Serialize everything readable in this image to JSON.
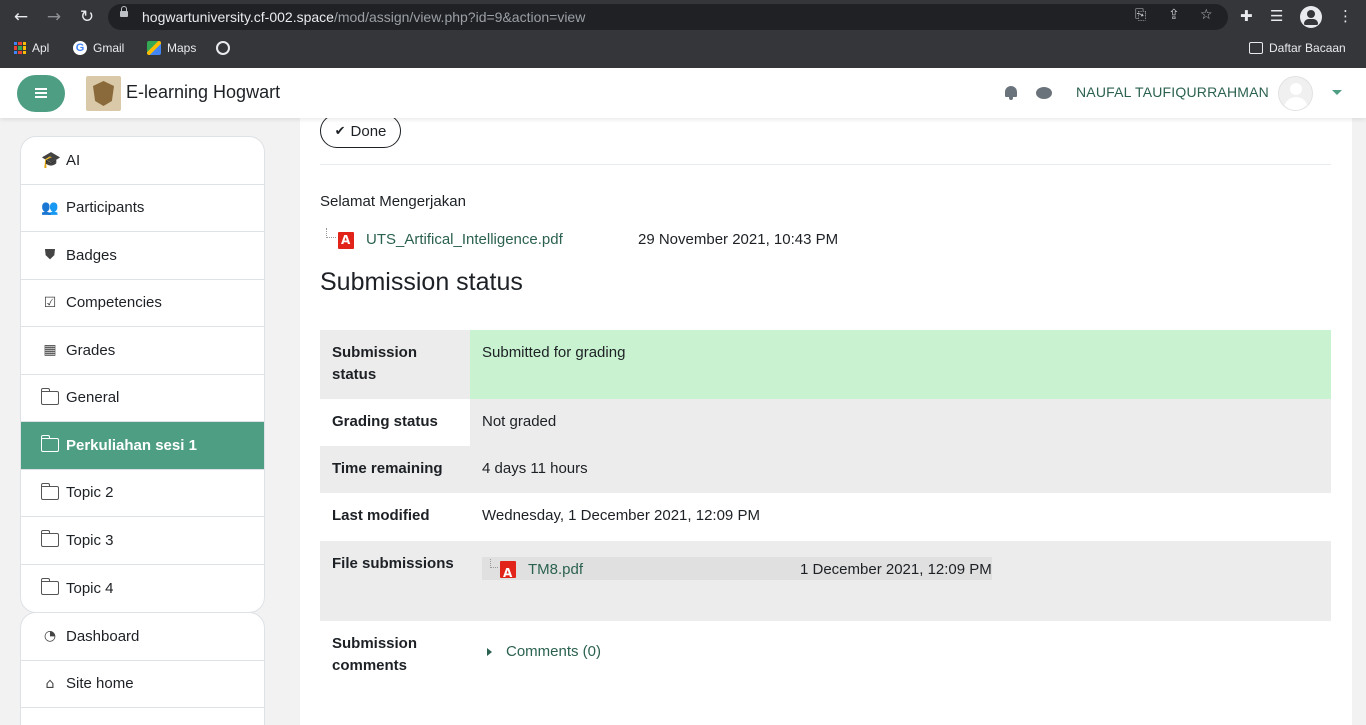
{
  "browser": {
    "url_host": "hogwartuniversity.cf-002.space",
    "url_path": "/mod/assign/view.php?id=9&action=view",
    "bookmarks": [
      {
        "label": "Apl"
      },
      {
        "label": "Gmail"
      },
      {
        "label": "Maps"
      }
    ],
    "reading_list": "Daftar Bacaan"
  },
  "navbar": {
    "site_name": "E-learning Hogwart",
    "user_name": "NAUFAL TAUFIQURRAHMAN"
  },
  "sidebar": {
    "course_items": [
      {
        "label": "AI"
      },
      {
        "label": "Participants"
      },
      {
        "label": "Badges"
      },
      {
        "label": "Competencies"
      },
      {
        "label": "Grades"
      },
      {
        "label": "General"
      },
      {
        "label": "Perkuliahan sesi 1"
      },
      {
        "label": "Topic 2"
      },
      {
        "label": "Topic 3"
      },
      {
        "label": "Topic 4"
      }
    ],
    "site_items": [
      {
        "label": "Dashboard"
      },
      {
        "label": "Site home"
      }
    ]
  },
  "main": {
    "done_label": "Done",
    "intro": "Selamat Mengerjakan",
    "attachment": {
      "name": "UTS_Artifical_Intelligence.pdf",
      "date": "29 November 2021, 10:43 PM"
    },
    "heading": "Submission status",
    "rows": [
      {
        "label": "Submission status",
        "value": "Submitted for grading"
      },
      {
        "label": "Grading status",
        "value": "Not graded"
      },
      {
        "label": "Time remaining",
        "value": "4 days 11 hours"
      },
      {
        "label": "Last modified",
        "value": "Wednesday, 1 December 2021, 12:09 PM"
      },
      {
        "label": "File submissions",
        "file_name": "TM8.pdf",
        "file_date": "1 December 2021, 12:09 PM"
      },
      {
        "label": "Submission comments",
        "comments_link": "Comments (0)"
      }
    ]
  },
  "colors": {
    "brand": "#4e9e84",
    "link": "#2b6150",
    "submitted_bg": "#c8f2d0",
    "pdf_red": "#e2231a"
  }
}
